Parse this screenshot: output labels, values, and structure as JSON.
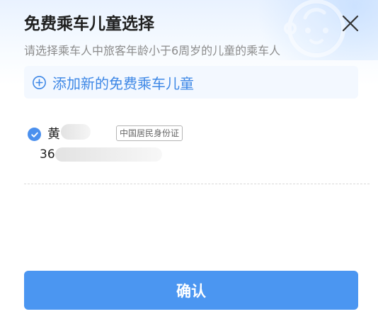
{
  "dialog": {
    "title": "免费乘车儿童选择",
    "subtitle": "请选择乘车人中旅客年龄小于6周岁的儿童的乘车人"
  },
  "add_child": {
    "label": "添加新的免费乘车儿童",
    "icon": "plus-circle-icon"
  },
  "passengers": [
    {
      "name": "黄",
      "id_type": "中国居民身份证",
      "id_number": "36",
      "selected": true
    }
  ],
  "confirm": {
    "label": "确认"
  },
  "colors": {
    "accent": "#4B96F1",
    "accent_text": "#3D87E6",
    "title_text": "#1F1F1F",
    "subtitle_text": "#8C8C8C",
    "add_bg": "#F3F8FF"
  }
}
